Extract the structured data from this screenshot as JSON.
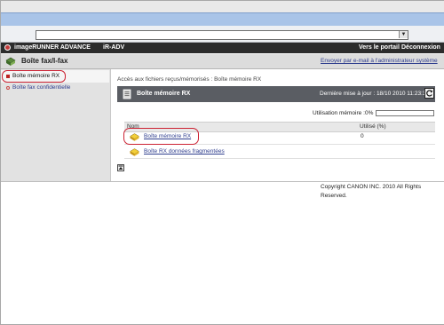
{
  "product": {
    "name": "imageRUNNER ADVANCE",
    "device": "iR-ADV",
    "portal_link": "Vers le portail",
    "logout_link": "Déconnexion"
  },
  "function": {
    "title": "Boîte fax/I-fax",
    "email_admin_link": "Envoyer par e-mail à l'administrateur système"
  },
  "sidebar": {
    "items": [
      {
        "label": "Boîte mémoire RX",
        "selected": true
      },
      {
        "label": "Boîte fax confidentielle",
        "selected": false
      }
    ]
  },
  "main": {
    "breadcrumb": "Accès aux fichiers reçus/mémorisés : Boîte mémoire RX",
    "panel_title": "Boîte mémoire RX",
    "last_update": "Dernière mise à jour : 18/10 2010 11:23:30",
    "memory_label": "Utilisation mémoire :",
    "memory_value": "0%",
    "memory_fraction": 0.0,
    "columns": {
      "name": "Nom",
      "used": "Utilisé (%)"
    },
    "rows": [
      {
        "name": "Boîte mémoire RX",
        "used": "0"
      },
      {
        "name": "Boîte RX données fragmentées",
        "used": ""
      }
    ]
  },
  "footer": {
    "copyright": "Copyright CANON INC. 2010 All Rights Reserved."
  },
  "colors": {
    "highlight": "#cc2233",
    "link": "#2f3e8e",
    "panel_header": "#5a5d63"
  }
}
